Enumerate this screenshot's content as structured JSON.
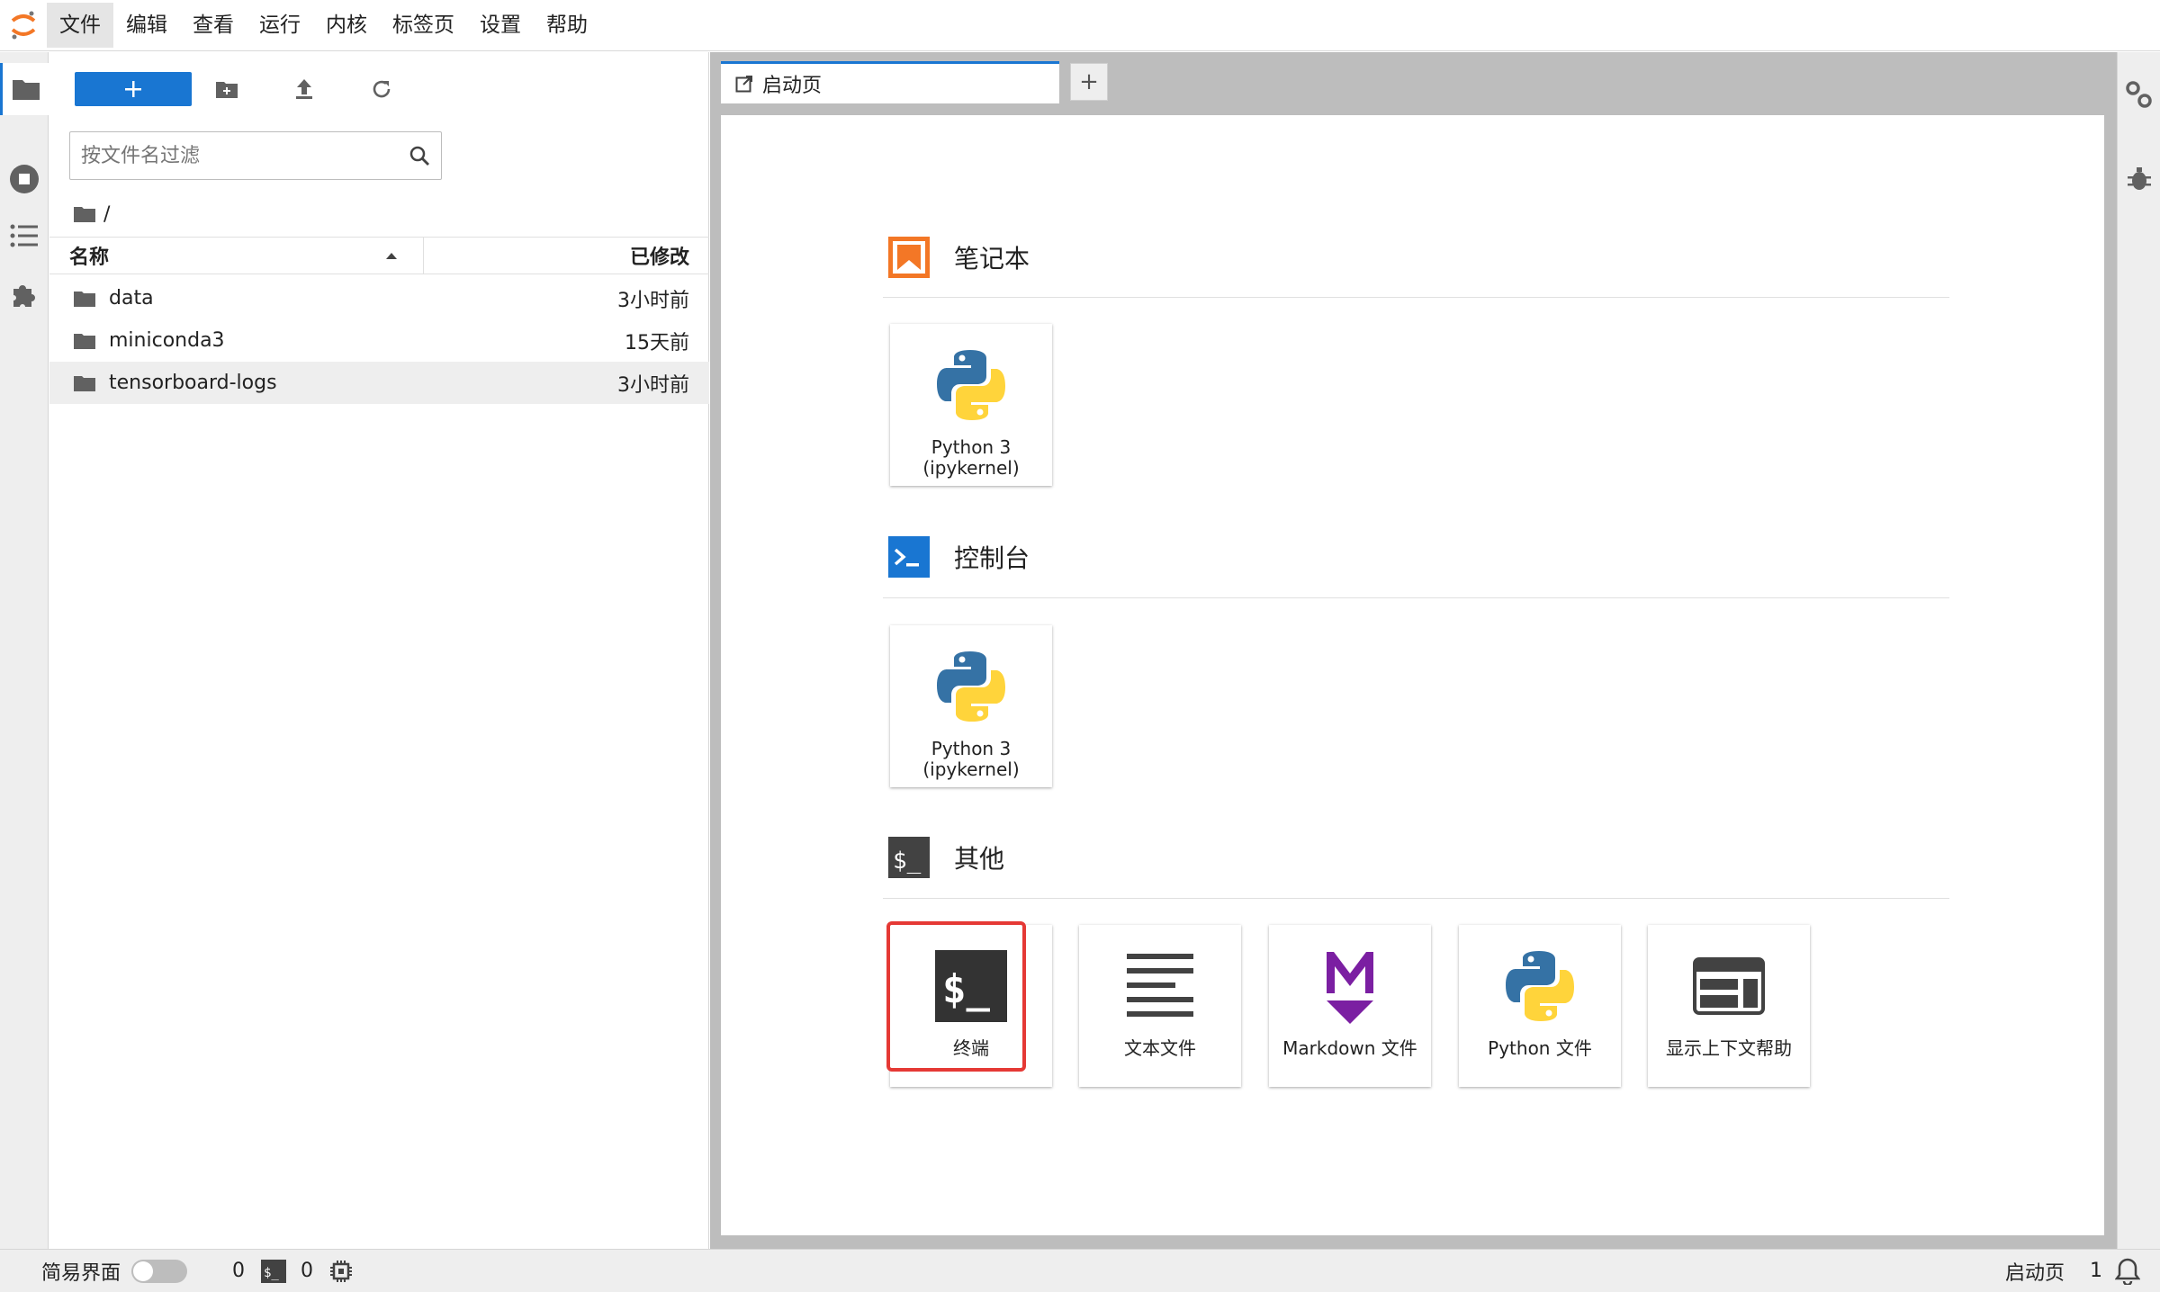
{
  "menubar": {
    "items": [
      "文件",
      "编辑",
      "查看",
      "运行",
      "内核",
      "标签页",
      "设置",
      "帮助"
    ]
  },
  "filebrowser": {
    "filter_placeholder": "按文件名过滤",
    "breadcrumb": "/",
    "col_name": "名称",
    "col_modified": "已修改",
    "files": [
      {
        "name": "data",
        "modified": "3小时前"
      },
      {
        "name": "miniconda3",
        "modified": "15天前"
      },
      {
        "name": "tensorboard-logs",
        "modified": "3小时前"
      }
    ]
  },
  "main": {
    "tab_label": "启动页",
    "add_tab": "+"
  },
  "launcher": {
    "notebook_title": "笔记本",
    "console_title": "控制台",
    "other_title": "其他",
    "notebook_card": "Python 3\n(ipykernel)",
    "console_card": "Python 3\n(ipykernel)",
    "other_cards": [
      "终端",
      "文本文件",
      "Markdown 文件",
      "Python 文件",
      "显示上下文帮助"
    ]
  },
  "statusbar": {
    "simple_mode": "简易界面",
    "kernels_count": "0",
    "terminals_count": "0",
    "right_label": "启动页",
    "notifications": "1"
  },
  "colors": {
    "accent": "#1976d2",
    "notebook_orange": "#f37726",
    "markdown_purple": "#7b1fa2",
    "highlight_red": "#e53935"
  }
}
